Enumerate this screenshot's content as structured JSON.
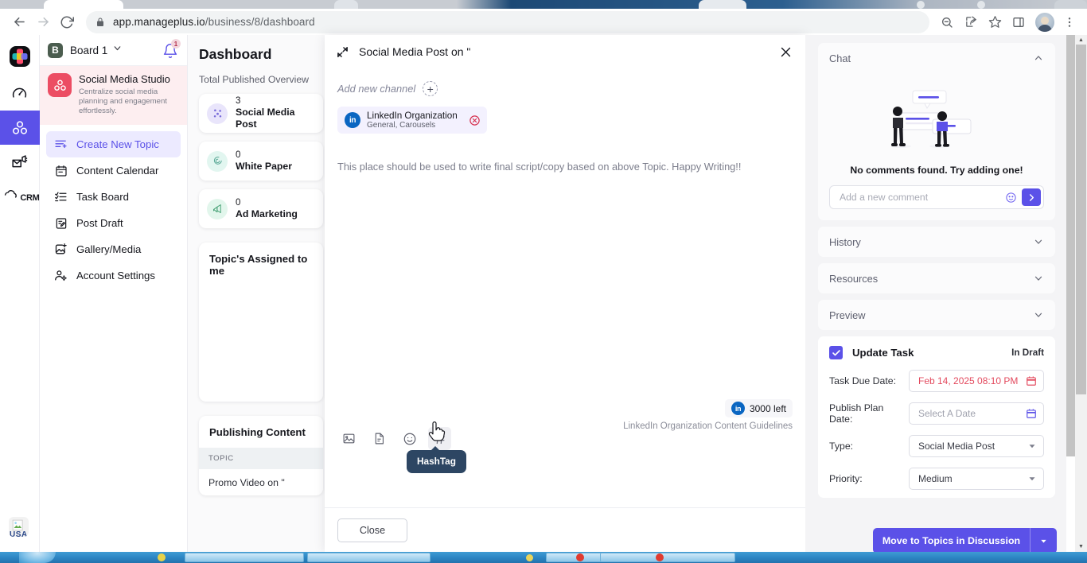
{
  "browser": {
    "url_main": "app.manageplus.io",
    "url_path": "/business/8/dashboard",
    "back_icon": "back-arrow-icon",
    "forward_icon": "forward-arrow-icon",
    "reload_icon": "reload-icon",
    "lock_icon": "lock-icon",
    "zoom_out_icon": "zoom-out-icon",
    "share_icon": "share-icon",
    "bookmark_icon": "star-icon",
    "sidepanel_icon": "side-panel-icon",
    "menu_icon": "three-dot-menu-icon"
  },
  "rail": {
    "items": [
      {
        "name": "app-logo",
        "label": ""
      },
      {
        "name": "dashboard-speedometer-icon",
        "label": ""
      },
      {
        "name": "social-media-studio-icon",
        "label": ""
      },
      {
        "name": "campaign-mail-icon",
        "label": ""
      },
      {
        "name": "crm-icon",
        "label": "CRM"
      }
    ],
    "bottom_label": "USA"
  },
  "sidebar": {
    "board": {
      "initial": "B",
      "name": "Board 1",
      "notification_count": "1"
    },
    "studio": {
      "title": "Social Media Studio",
      "subtitle": "Centralize social media planning and engagement effortlessly."
    },
    "items": [
      {
        "label": "Create New Topic",
        "icon": "create-topic-icon",
        "active": true
      },
      {
        "label": "Content Calendar",
        "icon": "calendar-icon",
        "active": false
      },
      {
        "label": "Task Board",
        "icon": "task-list-icon",
        "active": false
      },
      {
        "label": "Post Draft",
        "icon": "draft-document-icon",
        "active": false
      },
      {
        "label": "Gallery/Media",
        "icon": "gallery-add-icon",
        "active": false
      },
      {
        "label": "Account Settings",
        "icon": "account-settings-icon",
        "active": false
      }
    ]
  },
  "dashboard": {
    "title": "Dashboard",
    "overview_label": "Total Published Overview",
    "stats": [
      {
        "count": "3",
        "label": "Social Media Post",
        "icon": "network-nodes-icon",
        "bg": "#e9e5fb",
        "fg": "#6f62d6"
      },
      {
        "count": "0",
        "label": "White Paper",
        "icon": "whitepaper-icon",
        "bg": "#e2f6f0",
        "fg": "#5aa896"
      },
      {
        "count": "0",
        "label": "Ad Marketing",
        "icon": "ad-megaphone-icon",
        "bg": "#e2f6ec",
        "fg": "#49a277"
      }
    ],
    "assigned_title": "Topic's Assigned to me",
    "publishing_title": "Publishing Content",
    "publishing_column": "TOPIC",
    "publishing_rows": [
      {
        "topic": "Promo Video on \""
      }
    ]
  },
  "modal": {
    "expand_icon": "expand-icon",
    "title": "Social Media Post on \"",
    "close_icon": "close-icon",
    "add_channel_label": "Add new channel",
    "add_channel_icon": "plus-icon",
    "channels": [
      {
        "badge": "in",
        "name": "LinkedIn Organization",
        "sub": "General, Carousels",
        "remove_icon": "remove-circle-icon"
      }
    ],
    "editor_placeholder": "This place should be used to write final script/copy based on above Topic. Happy Writing!!",
    "toolbar": [
      {
        "name": "insert-image-icon",
        "label": "Image"
      },
      {
        "name": "insert-document-icon",
        "label": "Document"
      },
      {
        "name": "insert-emoji-icon",
        "label": "Emoji"
      },
      {
        "name": "insert-hashtag-icon",
        "label": "HashTag"
      }
    ],
    "tooltip_text": "HashTag",
    "counter_badge": "in",
    "counter_text": "3000 left",
    "guidelines_text": "LinkedIn Organization Content Guidelines",
    "close_button": "Close"
  },
  "right": {
    "chat": {
      "header": "Chat",
      "collapse_icon": "chevron-up-icon",
      "empty_text": "No comments found. Try adding one!",
      "comment_placeholder": "Add a new comment",
      "comment_value": "",
      "emoji_icon": "emoji-icon",
      "send_icon": "send-arrow-icon"
    },
    "sections": [
      {
        "label": "History",
        "icon": "chevron-down-icon"
      },
      {
        "label": "Resources",
        "icon": "chevron-down-icon"
      },
      {
        "label": "Preview",
        "icon": "chevron-down-icon"
      }
    ],
    "task": {
      "checkbox_checked": true,
      "title": "Update Task",
      "status": "In Draft",
      "fields": [
        {
          "label": "Task Due Date:",
          "value": "Feb 14, 2025 08:10 PM",
          "placeholder": "",
          "state": "red",
          "control": "date",
          "icon": "calendar-red-icon"
        },
        {
          "label": "Publish Plan Date:",
          "value": "",
          "placeholder": "Select A Date",
          "state": "placeholder",
          "control": "date",
          "icon": "calendar-blue-icon"
        },
        {
          "label": "Type:",
          "value": "Social Media Post",
          "placeholder": "",
          "state": "normal",
          "control": "select",
          "icon": "chevron-down-icon"
        },
        {
          "label": "Priority:",
          "value": "Medium",
          "placeholder": "",
          "state": "normal",
          "control": "select",
          "icon": "chevron-down-icon"
        }
      ]
    },
    "primary_action": {
      "label": "Move to Topics in Discussion",
      "split_icon": "chevron-down-icon"
    }
  },
  "colors": {
    "accent": "#5b51e8",
    "studio": "#ec4d63",
    "linkedin": "#0a66c2",
    "danger": "#e34a5e",
    "tooltip": "#2d4663"
  }
}
